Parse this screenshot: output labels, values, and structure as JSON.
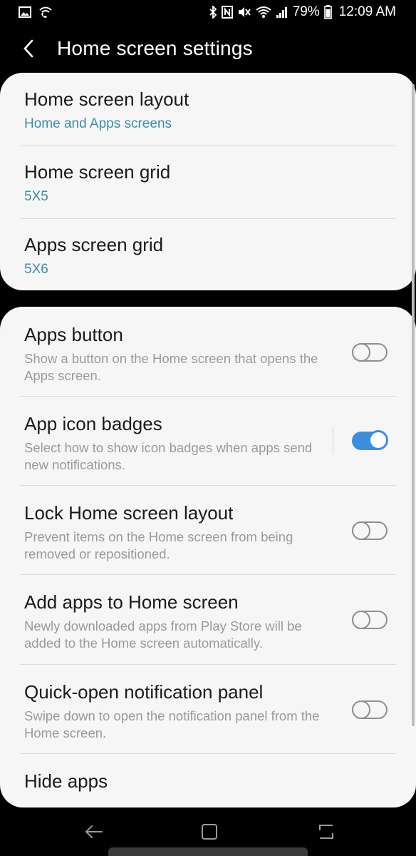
{
  "status_bar": {
    "battery": "79%",
    "time": "12:09 AM",
    "left_icons": [
      "gallery-icon",
      "wifi-call-icon"
    ],
    "right_icons": [
      "bluetooth-icon",
      "nfc-icon",
      "mute-icon",
      "wifi-icon",
      "signal-icon",
      "battery-icon"
    ]
  },
  "header": {
    "title": "Home screen settings",
    "back_icon": "back-arrow-icon"
  },
  "layout_group": {
    "items": [
      {
        "title": "Home screen layout",
        "value": "Home and Apps screens"
      },
      {
        "title": "Home screen grid",
        "value": "5X5"
      },
      {
        "title": "Apps screen grid",
        "value": "5X6"
      }
    ]
  },
  "options_group": {
    "items": [
      {
        "title": "Apps button",
        "description": "Show a button on the Home screen that opens the Apps screen.",
        "enabled": false
      },
      {
        "title": "App icon badges",
        "description": "Select how to show icon badges when apps send new notifications.",
        "enabled": true
      },
      {
        "title": "Lock Home screen layout",
        "description": "Prevent items on the Home screen from being removed or repositioned.",
        "enabled": false
      },
      {
        "title": "Add apps to Home screen",
        "description": "Newly downloaded apps from Play Store will be added to the Home screen automatically.",
        "enabled": false
      },
      {
        "title": "Quick-open notification panel",
        "description": "Swipe down to open the notification panel from the Home screen.",
        "enabled": false
      },
      {
        "title": "Hide apps"
      }
    ]
  },
  "nav_bar": {
    "buttons": [
      "back-icon",
      "home-icon",
      "recents-icon"
    ]
  },
  "colors": {
    "accent_blue": "#3e8ede",
    "value_teal": "#3c8fa6",
    "card_bg": "#f6f6f6",
    "background": "#000000"
  }
}
